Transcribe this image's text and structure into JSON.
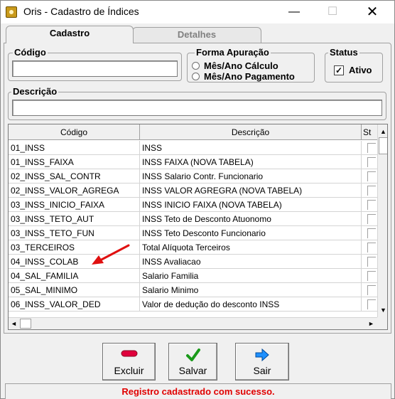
{
  "window": {
    "title": "Oris - Cadastro de Índices",
    "minimize": "—",
    "maximize": "☐",
    "close": "✕"
  },
  "tabs": [
    {
      "label": "Cadastro"
    },
    {
      "label": "Detalhes"
    }
  ],
  "form": {
    "codigo": {
      "label": "Código",
      "value": ""
    },
    "apuracao": {
      "label": "Forma Apuração",
      "options": [
        "Mês/Ano Cálculo",
        "Mês/Ano Pagamento"
      ]
    },
    "status": {
      "label": "Status",
      "checkbox_label": "Ativo",
      "checked": true,
      "check_glyph": "✓"
    },
    "descricao": {
      "label": "Descrição",
      "value": ""
    }
  },
  "grid": {
    "columns": [
      "Código",
      "Descrição",
      "St"
    ],
    "rows": [
      {
        "codigo": "01_INSS",
        "descricao": "INSS"
      },
      {
        "codigo": "01_INSS_FAIXA",
        "descricao": "INSS FAIXA (NOVA TABELA)"
      },
      {
        "codigo": "02_INSS_SAL_CONTR",
        "descricao": "INSS Salario Contr. Funcionario"
      },
      {
        "codigo": "02_INSS_VALOR_AGREGA",
        "descricao": "INSS VALOR AGREGRA (NOVA TABELA)"
      },
      {
        "codigo": "03_INSS_INICIO_FAIXA",
        "descricao": "INSS INICIO FAIXA (NOVA TABELA)"
      },
      {
        "codigo": "03_INSS_TETO_AUT",
        "descricao": "INSS Teto de Desconto Atuonomo"
      },
      {
        "codigo": "03_INSS_TETO_FUN",
        "descricao": "INSS Teto Desconto Funcionario"
      },
      {
        "codigo": "03_TERCEIROS",
        "descricao": "Total Alíquota Terceiros"
      },
      {
        "codigo": "04_INSS_COLAB",
        "descricao": "INSS Avaliacao"
      },
      {
        "codigo": "04_SAL_FAMILIA",
        "descricao": "Salario Familia"
      },
      {
        "codigo": "05_SAL_MINIMO",
        "descricao": "Salario Minimo"
      },
      {
        "codigo": "06_INSS_VALOR_DED",
        "descricao": "Valor de dedução do desconto INSS"
      }
    ],
    "scroll_up": "▲",
    "scroll_down": "▼",
    "scroll_left": "◄",
    "scroll_right": "►"
  },
  "buttons": {
    "excluir": "Excluir",
    "salvar": "Salvar",
    "sair": "Sair"
  },
  "status_message": "Registro cadastrado com sucesso.",
  "colors": {
    "status_text": "#e00000",
    "annotation_arrow": "#e01010",
    "salvar_icon": "#1a9a1a",
    "sair_icon": "#1e90ff",
    "excluir_icon": "#e0003c"
  }
}
